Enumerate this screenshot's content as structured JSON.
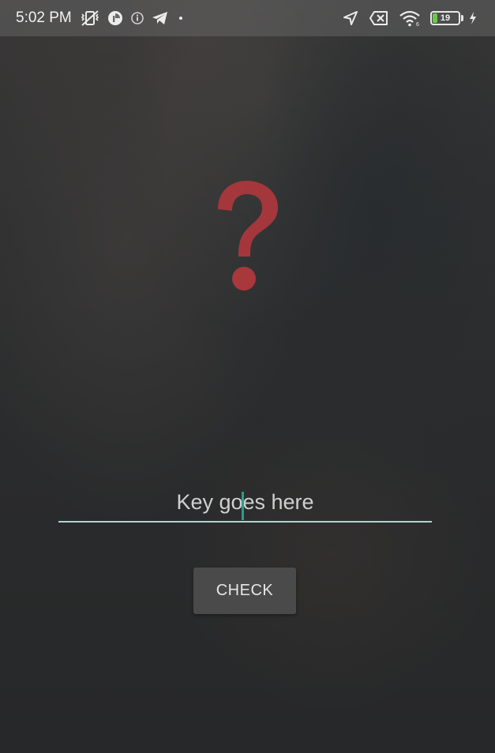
{
  "status_bar": {
    "time": "5:02 PM",
    "battery_level": "19",
    "left_icons": [
      "vibrate-off-icon",
      "data-saver-icon",
      "info-icon",
      "telegram-icon",
      "dot-icon"
    ],
    "right_icons": [
      "location-arrow-icon",
      "no-sim-icon",
      "wifi-icon",
      "battery-icon",
      "charging-bolt-icon"
    ]
  },
  "main": {
    "hero_icon": "question-mark-icon",
    "hero_color": "#b3383c",
    "key_input": {
      "placeholder": "Key goes here",
      "value": ""
    },
    "check_button_label": "CHECK"
  },
  "colors": {
    "input_underline": "#a9d7cf",
    "cursor": "#2a9d8a",
    "battery_fill": "#6cc84c"
  }
}
